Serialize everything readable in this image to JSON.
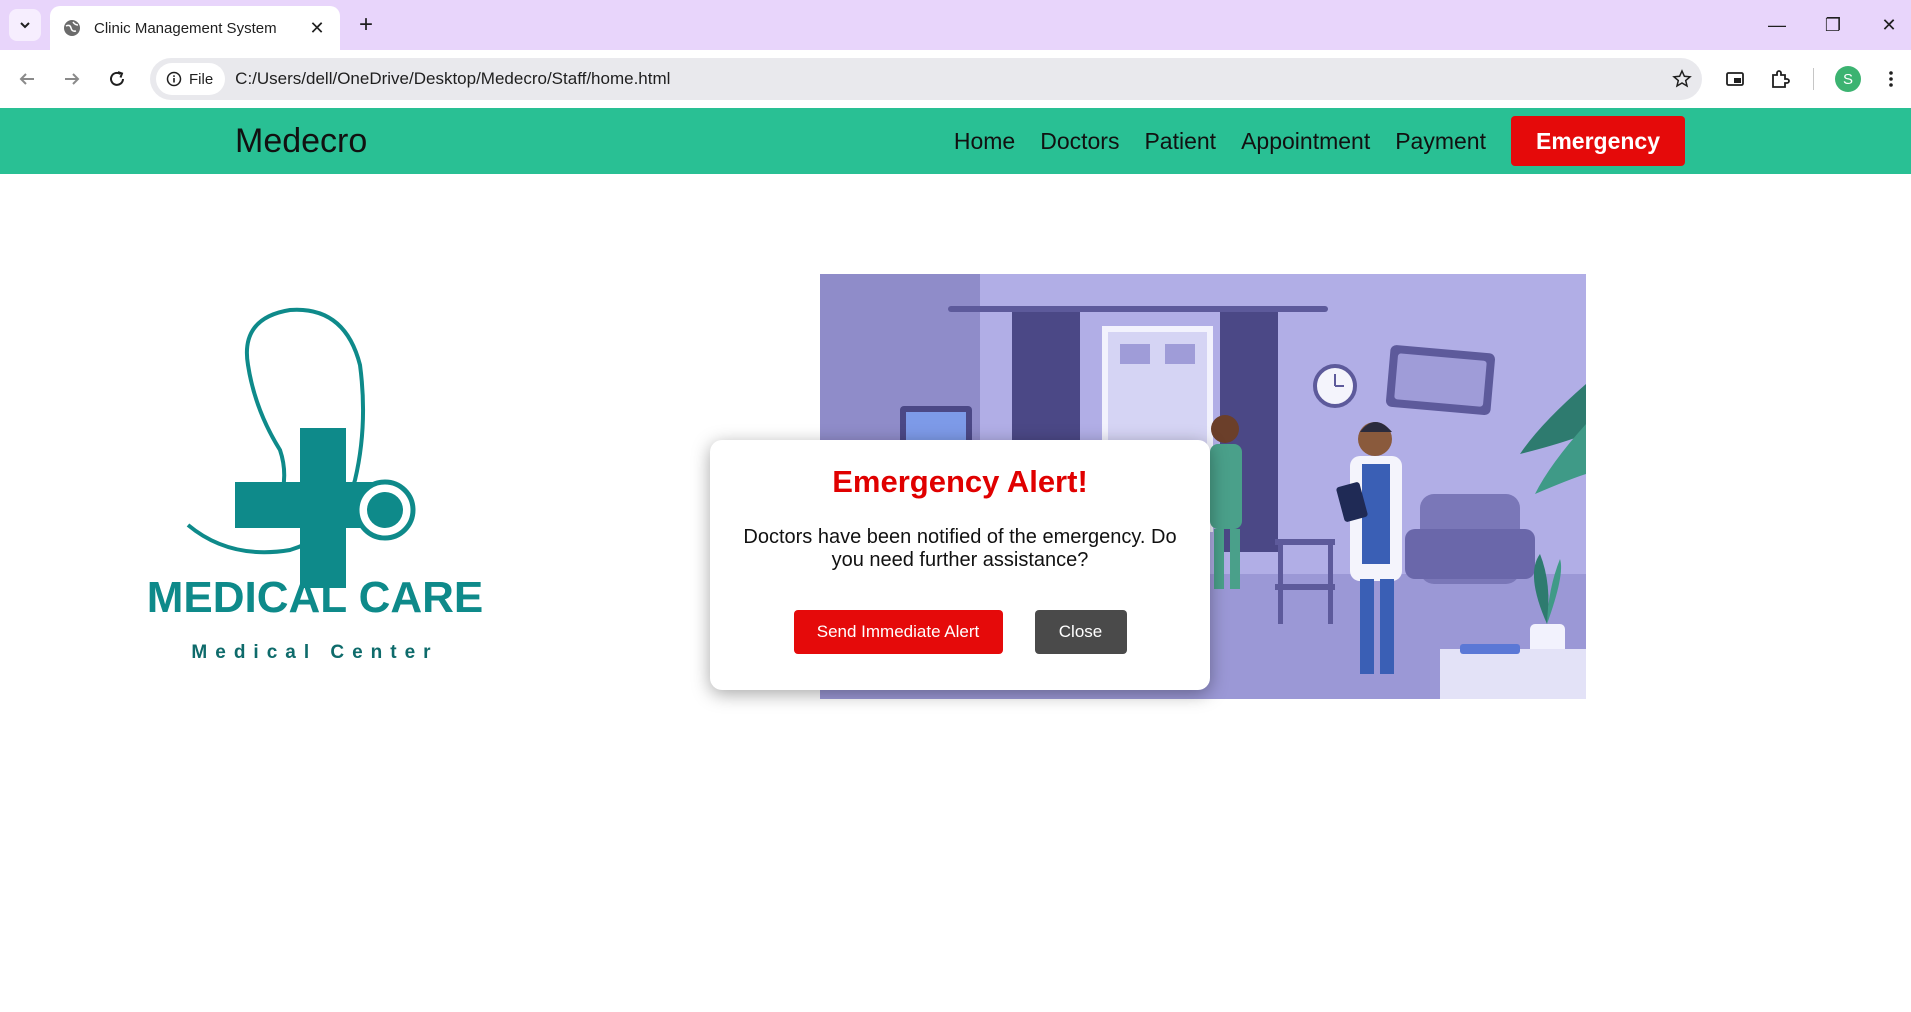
{
  "browser": {
    "tab_title": "Clinic Management System",
    "chip_label": "File",
    "url": "C:/Users/dell/OneDrive/Desktop/Medecro/Staff/home.html",
    "profile_initial": "S"
  },
  "navbar": {
    "brand": "Medecro",
    "links": [
      "Home",
      "Doctors",
      "Patient",
      "Appointment",
      "Payment"
    ],
    "emergency_label": "Emergency",
    "background": "#29c094",
    "emergency_color": "#e50a0a"
  },
  "logo": {
    "title": "MEDICAL CARE",
    "subtitle": "Medical Center",
    "color": "#0e8a8a"
  },
  "modal": {
    "title": "Emergency Alert!",
    "message": "Doctors have been notified of the emergency. Do you need further assistance?",
    "primary_label": "Send Immediate Alert",
    "secondary_label": "Close"
  }
}
